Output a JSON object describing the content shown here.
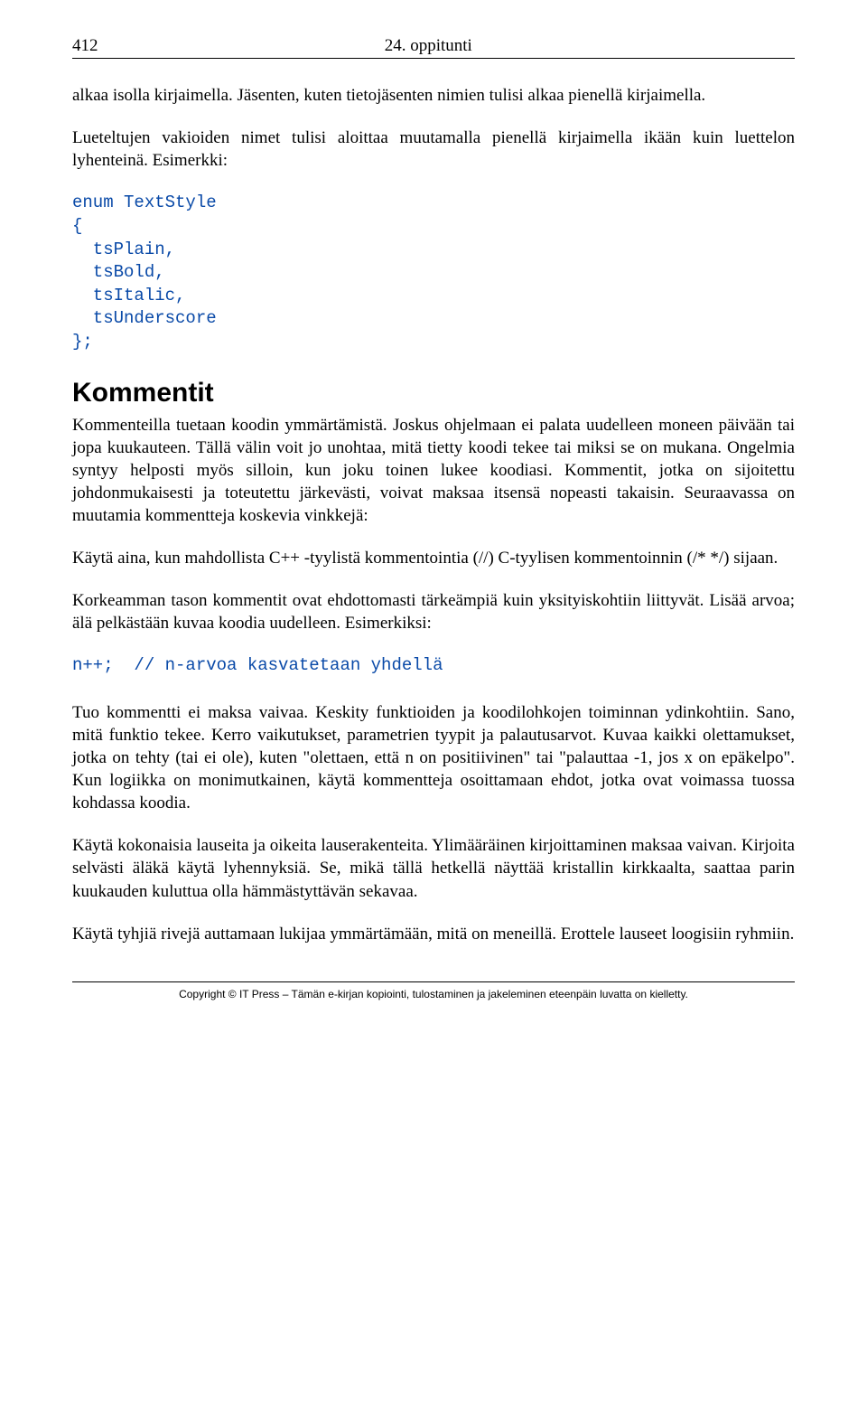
{
  "header": {
    "page_number": "412",
    "chapter": "24. oppitunti"
  },
  "paragraphs": {
    "p1": "alkaa isolla kirjaimella. Jäsenten, kuten tietojäsenten nimien tulisi alkaa pienellä kirjaimella.",
    "p2": "Lueteltujen vakioiden nimet tulisi aloittaa muutamalla pienellä kirjaimella ikään kuin luettelon lyhenteinä. Esimerkki:"
  },
  "code1": "enum TextStyle\n{\n  tsPlain,\n  tsBold,\n  tsItalic,\n  tsUnderscore\n};",
  "section_heading": "Kommentit",
  "kommentit": {
    "p1": "Kommenteilla tuetaan koodin ymmärtämistä. Joskus ohjelmaan ei palata uudelleen moneen päivään tai jopa kuukauteen. Tällä välin voit jo unohtaa, mitä tietty koodi tekee tai miksi se on mukana. Ongelmia syntyy helposti myös silloin, kun joku toinen lukee koodiasi. Kommentit, jotka on sijoitettu johdonmukaisesti ja toteutettu järkevästi, voivat maksaa itsensä nopeasti takaisin. Seuraavassa on muutamia kommentteja koskevia vinkkejä:",
    "p2": "Käytä aina, kun mahdollista C++ -tyylistä kommentointia (//) C-tyylisen kommentoinnin (/* */) sijaan.",
    "p3": "Korkeamman tason kommentit ovat ehdottomasti tärkeämpiä kuin yksityiskohtiin liittyvät. Lisää arvoa; älä pelkästään kuvaa koodia uudelleen. Esimerkiksi:",
    "code2": "n++;  // n-arvoa kasvatetaan yhdellä",
    "p4": "Tuo kommentti ei maksa vaivaa. Keskity funktioiden ja koodilohkojen toiminnan ydinkohtiin. Sano, mitä funktio tekee. Kerro vaikutukset, parametrien tyypit ja palautusarvot. Kuvaa kaikki olettamukset, jotka on tehty (tai ei ole), kuten \"olettaen, että n on positiivinen\" tai \"palauttaa -1, jos x on epäkelpo\". Kun logiikka on monimutkainen, käytä kommentteja osoittamaan ehdot, jotka ovat voimassa tuossa kohdassa koodia.",
    "p5": "Käytä kokonaisia lauseita ja oikeita lauserakenteita. Ylimääräinen kirjoittaminen maksaa vaivan. Kirjoita selvästi äläkä käytä lyhennyksiä. Se, mikä tällä hetkellä näyttää kristallin kirkkaalta, saattaa parin kuukauden kuluttua olla hämmästyttävän sekavaa.",
    "p6": "Käytä tyhjiä rivejä auttamaan lukijaa ymmärtämään, mitä on meneillä. Erottele lauseet loogisiin ryhmiin."
  },
  "footer": "Copyright © IT Press – Tämän e-kirjan kopiointi, tulostaminen ja jakeleminen eteenpäin luvatta on kielletty."
}
